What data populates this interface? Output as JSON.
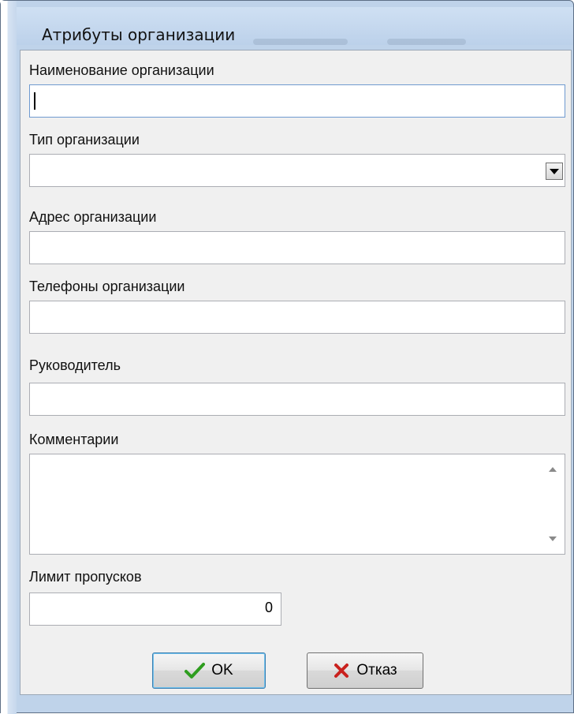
{
  "window": {
    "title": "Атрибуты организации"
  },
  "form": {
    "name": {
      "label": "Наименование организации",
      "value": ""
    },
    "type": {
      "label": "Тип организации",
      "value": ""
    },
    "address": {
      "label": "Адрес организации",
      "value": ""
    },
    "phones": {
      "label": "Телефоны организации",
      "value": ""
    },
    "manager": {
      "label": "Руководитель",
      "value": ""
    },
    "comments": {
      "label": "Комментарии",
      "value": ""
    },
    "limit": {
      "label": "Лимит пропусков",
      "value": "0"
    }
  },
  "buttons": {
    "ok": "OK",
    "cancel": "Отказ"
  },
  "icons": {
    "ok": "checkmark-icon",
    "cancel": "x-icon"
  },
  "colors": {
    "ok_icon": "#2e9d1f",
    "cancel_icon": "#c9211e"
  }
}
